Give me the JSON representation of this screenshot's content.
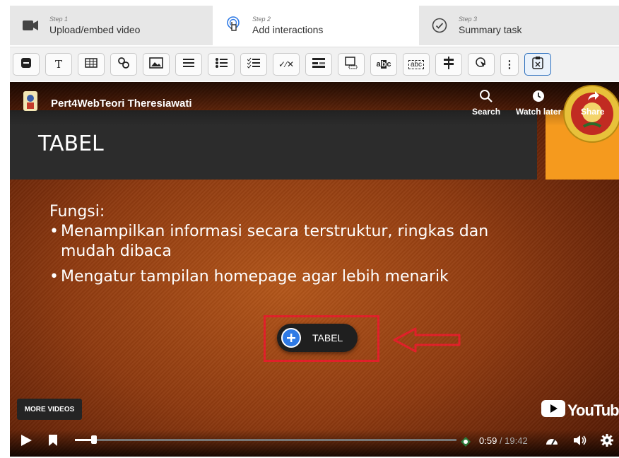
{
  "steps": [
    {
      "num": "Step 1",
      "label": "Upload/embed video",
      "icon": "video-camera-icon"
    },
    {
      "num": "Step 2",
      "label": "Add interactions",
      "icon": "touch-pointer-icon"
    },
    {
      "num": "Step 3",
      "label": "Summary task",
      "icon": "check-circle-icon"
    }
  ],
  "toolbar": {
    "text_label": "T",
    "tools": [
      "label",
      "text",
      "table",
      "link",
      "image",
      "statements",
      "single-choice",
      "multiple-choice",
      "true-false",
      "drag-drop",
      "mark-words",
      "fill-blanks",
      "drag-text",
      "crossroads",
      "navigation-hotspot",
      "more",
      "submit-screen"
    ]
  },
  "video": {
    "channel_name": "Pert4WebTeori Theresiawati",
    "search_label": "Search",
    "watch_later_label": "Watch later",
    "share_label": "Share",
    "slide_title": "TABEL",
    "slide_heading": "Fungsi:",
    "bullet_1": "Menampilkan informasi secara terstruktur, ringkas dan mudah dibaca",
    "bullet_2": "Mengatur tampilan homepage agar lebih menarik",
    "bullet_char": "•",
    "interaction_label": "TABEL",
    "more_videos_label": "MORE VIDEOS",
    "youtube_label": "YouTube",
    "current_time": "0:59",
    "duration": "/ 19:42",
    "progress": 0.05
  },
  "colors": {
    "accent": "#2f7ae5",
    "highlight": "#e0202a",
    "title_band": "#2c2c2c",
    "orange": "#f59a1e"
  }
}
